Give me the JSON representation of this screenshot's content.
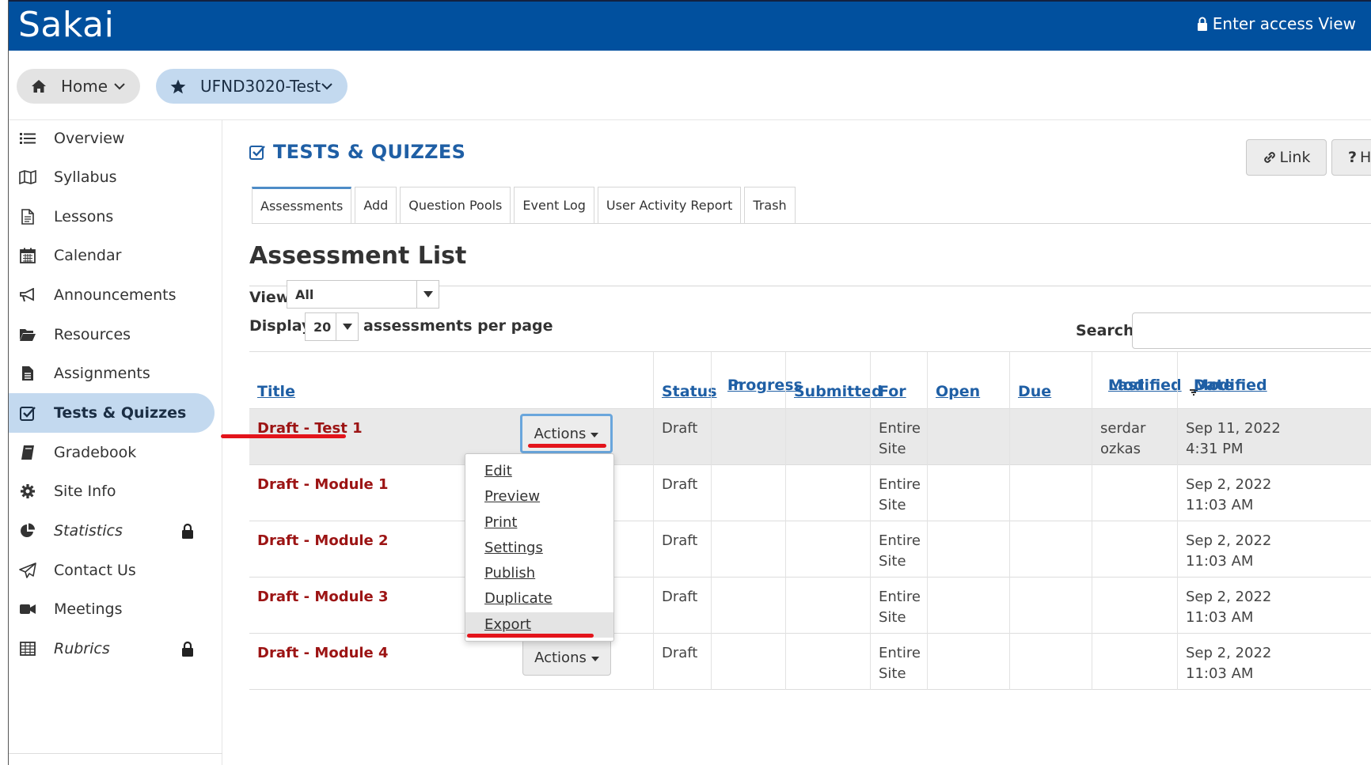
{
  "brand": {
    "name": "Sakai"
  },
  "header": {
    "access_label": "Enter access View"
  },
  "sitenav": {
    "home_label": "Home",
    "site_label": "UFND3020-Test"
  },
  "tools": [
    {
      "label": "Overview",
      "icon": "list-icon"
    },
    {
      "label": "Syllabus",
      "icon": "map-icon"
    },
    {
      "label": "Lessons",
      "icon": "document-icon"
    },
    {
      "label": "Calendar",
      "icon": "calendar-icon"
    },
    {
      "label": "Announcements",
      "icon": "bullhorn-icon"
    },
    {
      "label": "Resources",
      "icon": "folder-open-icon"
    },
    {
      "label": "Assignments",
      "icon": "file-text-icon"
    },
    {
      "label": "Tests & Quizzes",
      "icon": "check-square-icon",
      "active": true
    },
    {
      "label": "Gradebook",
      "icon": "book-icon"
    },
    {
      "label": "Site Info",
      "icon": "gear-icon"
    },
    {
      "label": "Statistics",
      "icon": "pie-chart-icon",
      "locked": true
    },
    {
      "label": "Contact Us",
      "icon": "paper-plane-icon"
    },
    {
      "label": "Meetings",
      "icon": "video-camera-icon"
    },
    {
      "label": "Rubrics",
      "icon": "table-icon",
      "locked": true
    }
  ],
  "main": {
    "tool_title": "TESTS & QUIZZES",
    "link_button": "Link",
    "help_button": "He",
    "tabs": [
      "Assessments",
      "Add",
      "Question Pools",
      "Event Log",
      "User Activity Report",
      "Trash"
    ],
    "heading": "Assessment List",
    "view_label": "View",
    "view_value": "All",
    "display_label": "Display",
    "display_value": "20",
    "per_page_label": "assessments per page",
    "search_label": "Search:"
  },
  "table": {
    "headers": {
      "title": "Title",
      "status": "Status",
      "in_progress_1": "In",
      "in_progress_2": "Progress",
      "submitted": "Submitted",
      "for": "For",
      "open": "Open",
      "due": "Due",
      "last_modified_1": "Last",
      "last_modified_2": "Modified",
      "modified_date_1": "Modified",
      "modified_date_2": "Date"
    },
    "rows": [
      {
        "prefix": "Draft",
        "title": " - Test 1",
        "status": "Draft",
        "for_1": "Entire",
        "for_2": "Site",
        "last_mod_1": "serdar",
        "last_mod_2": "ozkas",
        "date_1": "Sep 11, 2022",
        "date_2": "4:31 PM"
      },
      {
        "prefix": "Draft",
        "title": " - Module 1",
        "status": "Draft",
        "for_1": "Entire",
        "for_2": "Site",
        "last_mod_1": "",
        "last_mod_2": "",
        "date_1": "Sep 2, 2022",
        "date_2": "11:03 AM"
      },
      {
        "prefix": "Draft",
        "title": " - Module 2",
        "status": "Draft",
        "for_1": "Entire",
        "for_2": "Site",
        "last_mod_1": "",
        "last_mod_2": "",
        "date_1": "Sep 2, 2022",
        "date_2": "11:03 AM"
      },
      {
        "prefix": "Draft",
        "title": " - Module 3",
        "status": "Draft",
        "for_1": "Entire",
        "for_2": "Site",
        "last_mod_1": "",
        "last_mod_2": "",
        "date_1": "Sep 2, 2022",
        "date_2": "11:03 AM"
      },
      {
        "prefix": "Draft",
        "title": " - Module 4",
        "status": "Draft",
        "for_1": "Entire",
        "for_2": "Site",
        "last_mod_1": "",
        "last_mod_2": "",
        "date_1": "Sep 2, 2022",
        "date_2": "11:03 AM"
      }
    ],
    "actions_label": "Actions"
  },
  "actions_menu": [
    "Edit",
    "Preview",
    "Print",
    "Settings",
    "Publish",
    "Duplicate",
    "Export"
  ],
  "colors": {
    "topbar": "#01509e",
    "accent": "#1f5fa5",
    "active_tool": "#c3d9ef",
    "draft_title": "#9c1414",
    "annotation_red": "#e3141b"
  }
}
